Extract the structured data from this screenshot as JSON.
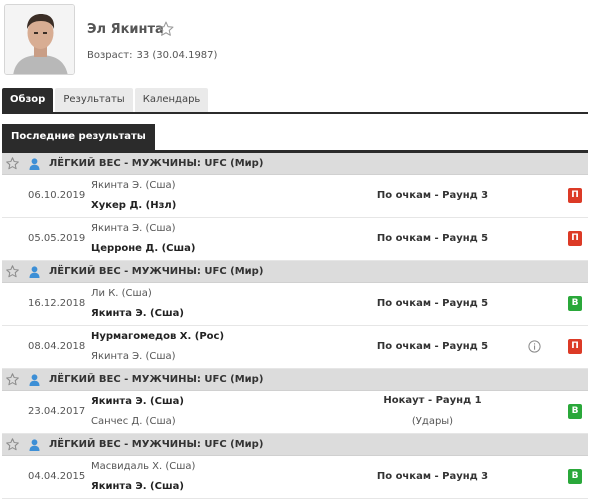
{
  "player": {
    "name": "Эл Якинта",
    "age_label": "Возраст:",
    "age_value": "33 (30.04.1987)"
  },
  "tabs": [
    {
      "label": "Обзор",
      "active": true
    },
    {
      "label": "Результаты",
      "active": false
    },
    {
      "label": "Календарь",
      "active": false
    }
  ],
  "section_title": "Последние результаты",
  "groups": [
    {
      "title": "ЛЁГКИЙ ВЕС - МУЖЧИНЫ: UFC (Мир)",
      "matches": [
        {
          "date": "06.10.2019",
          "p1": "Якинта Э. (Сша)",
          "p1_bold": false,
          "p2": "Хукер Д. (Нзл)",
          "p2_bold": true,
          "method": "По очкам - Раунд 3",
          "sub": "",
          "info": false,
          "result": "П",
          "result_type": "loss"
        },
        {
          "date": "05.05.2019",
          "p1": "Якинта Э. (Сша)",
          "p1_bold": false,
          "p2": "Церроне Д. (Сша)",
          "p2_bold": true,
          "method": "По очкам - Раунд 5",
          "sub": "",
          "info": false,
          "result": "П",
          "result_type": "loss"
        }
      ]
    },
    {
      "title": "ЛЁГКИЙ ВЕС - МУЖЧИНЫ: UFC (Мир)",
      "matches": [
        {
          "date": "16.12.2018",
          "p1": "Ли К. (Сша)",
          "p1_bold": false,
          "p2": "Якинта Э. (Сша)",
          "p2_bold": true,
          "method": "По очкам - Раунд 5",
          "sub": "",
          "info": false,
          "result": "В",
          "result_type": "win"
        },
        {
          "date": "08.04.2018",
          "p1": "Нурмагомедов Х. (Рос)",
          "p1_bold": true,
          "p2": "Якинта Э. (Сша)",
          "p2_bold": false,
          "method": "По очкам - Раунд 5",
          "sub": "",
          "info": true,
          "result": "П",
          "result_type": "loss"
        }
      ]
    },
    {
      "title": "ЛЁГКИЙ ВЕС - МУЖЧИНЫ: UFC (Мир)",
      "matches": [
        {
          "date": "23.04.2017",
          "p1": "Якинта Э. (Сша)",
          "p1_bold": true,
          "p2": "Санчес Д. (Сша)",
          "p2_bold": false,
          "method": "Нокаут - Раунд 1",
          "sub": "(Удары)",
          "info": false,
          "result": "В",
          "result_type": "win"
        }
      ]
    },
    {
      "title": "ЛЁГКИЙ ВЕС - МУЖЧИНЫ: UFC (Мир)",
      "matches": [
        {
          "date": "04.04.2015",
          "p1": "Масвидаль Х. (Сша)",
          "p1_bold": false,
          "p2": "Якинта Э. (Сша)",
          "p2_bold": true,
          "method": "По очкам - Раунд 3",
          "sub": "",
          "info": false,
          "result": "В",
          "result_type": "win"
        }
      ]
    }
  ],
  "colors": {
    "dark": "#2b2b2b",
    "loss": "#dc3a26",
    "win": "#2aa83a",
    "group_bg": "#dcdcdc",
    "icon_blue": "#3d8fd6"
  },
  "icons": {
    "favorite": "star-outline-icon",
    "person": "person-icon",
    "info": "info-circle-icon"
  }
}
